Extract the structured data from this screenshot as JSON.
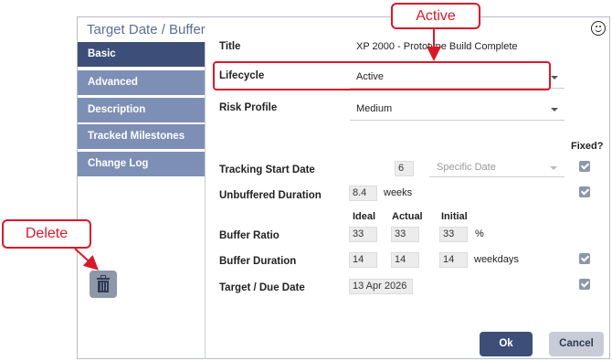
{
  "dialog": {
    "title": "Target Date / Buffer",
    "smiley_icon": "smiley-face-icon"
  },
  "sidebar": {
    "items": [
      {
        "label": "Basic",
        "active": true
      },
      {
        "label": "Advanced",
        "active": false
      },
      {
        "label": "Description",
        "active": false
      },
      {
        "label": "Tracked Milestones",
        "active": false
      },
      {
        "label": "Change Log",
        "active": false
      }
    ],
    "delete_icon": "trash-icon"
  },
  "form": {
    "title": {
      "label": "Title",
      "value": "XP 2000 - Prototype Build Complete"
    },
    "lifecycle": {
      "label": "Lifecycle",
      "value": "Active"
    },
    "risk_profile": {
      "label": "Risk Profile",
      "value": "Medium"
    },
    "fixed_header": "Fixed?",
    "tracking_start": {
      "label": "Tracking Start Date",
      "value": "6",
      "select_value": "Specific Date",
      "fixed": true
    },
    "unbuffered": {
      "label": "Unbuffered Duration",
      "value": "8.4",
      "unit": "weeks",
      "fixed": true
    },
    "columns": {
      "ideal": "Ideal",
      "actual": "Actual",
      "initial": "Initial"
    },
    "buffer_ratio": {
      "label": "Buffer Ratio",
      "ideal": "33",
      "actual": "33",
      "initial": "33",
      "unit": "%"
    },
    "buffer_duration": {
      "label": "Buffer Duration",
      "ideal": "14",
      "actual": "14",
      "initial": "14",
      "unit": "weekdays",
      "fixed": true
    },
    "target_date": {
      "label": "Target / Due Date",
      "value": "13 Apr 2026",
      "fixed": true
    }
  },
  "buttons": {
    "ok": "Ok",
    "cancel": "Cancel"
  },
  "annotations": {
    "active_callout": "Active",
    "delete_callout": "Delete",
    "color": "#d9192a"
  }
}
